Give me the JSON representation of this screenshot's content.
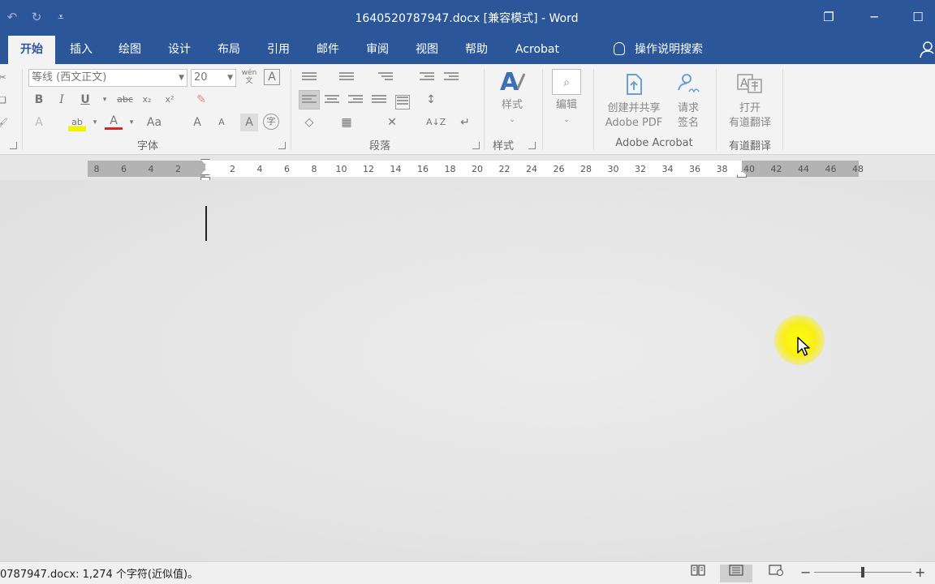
{
  "window": {
    "title": "1640520787947.docx [兼容模式]  -  Word",
    "qat": {
      "undo_icon": "undo-icon",
      "redo_icon": "redo-icon",
      "customize_icon": "customize-qat-icon",
      "customize_glyph": "⩡"
    },
    "controls": {
      "ribbon_display": "❐",
      "minimize": "─",
      "maximize": "☐"
    }
  },
  "tabs": [
    {
      "label": "开始",
      "active": true
    },
    {
      "label": "插入"
    },
    {
      "label": "绘图"
    },
    {
      "label": "设计"
    },
    {
      "label": "布局"
    },
    {
      "label": "引用"
    },
    {
      "label": "邮件"
    },
    {
      "label": "审阅"
    },
    {
      "label": "视图"
    },
    {
      "label": "帮助"
    },
    {
      "label": "Acrobat"
    }
  ],
  "tell_me": "操作说明搜索",
  "ribbon": {
    "font": {
      "font_name": "等线 (西文正文)",
      "font_size": "20",
      "wen_label": "wén\n文",
      "clear_format": "A",
      "bold": "B",
      "italic": "I",
      "underline": "U",
      "strikethrough": "abc",
      "subscript": "x₂",
      "superscript": "x²",
      "text_effects": "A",
      "highlight": "ab",
      "font_color": "A",
      "change_case": "Aa",
      "grow_font": "A",
      "shrink_font": "A",
      "char_shading": "A",
      "enclose": "字",
      "group_label": "字体"
    },
    "paragraph": {
      "group_label": "段落",
      "sort": "A↓Z",
      "marks": "↵"
    },
    "styles": {
      "label": "样式",
      "group_label": "样式"
    },
    "editing": {
      "label": "编辑"
    },
    "acrobat": {
      "create_share_line1": "创建并共享",
      "create_share_line2": "Adobe PDF",
      "request_sign_line1": "请求",
      "request_sign_line2": "签名",
      "group_label": "Adobe Acrobat"
    },
    "translate": {
      "line1": "打开",
      "line2": "有道翻译",
      "group_label": "有道翻译"
    }
  },
  "ruler": {
    "left_ticks": [
      "8",
      "6",
      "4",
      "2"
    ],
    "right_ticks": [
      "2",
      "4",
      "6",
      "8",
      "10",
      "12",
      "14",
      "16",
      "18",
      "20",
      "22",
      "24",
      "26",
      "28",
      "30",
      "32",
      "34",
      "36",
      "38",
      "40",
      "42",
      "44",
      "46",
      "48"
    ]
  },
  "status": {
    "text": "0787947.docx: 1,274 个字符(近似值)。",
    "read_mode_icon": "read-mode-icon",
    "print_layout_icon": "print-layout-icon",
    "web_layout_icon": "web-layout-icon",
    "zoom_minus": "−",
    "zoom_plus": "+",
    "zoom_fraction": 0.5
  }
}
